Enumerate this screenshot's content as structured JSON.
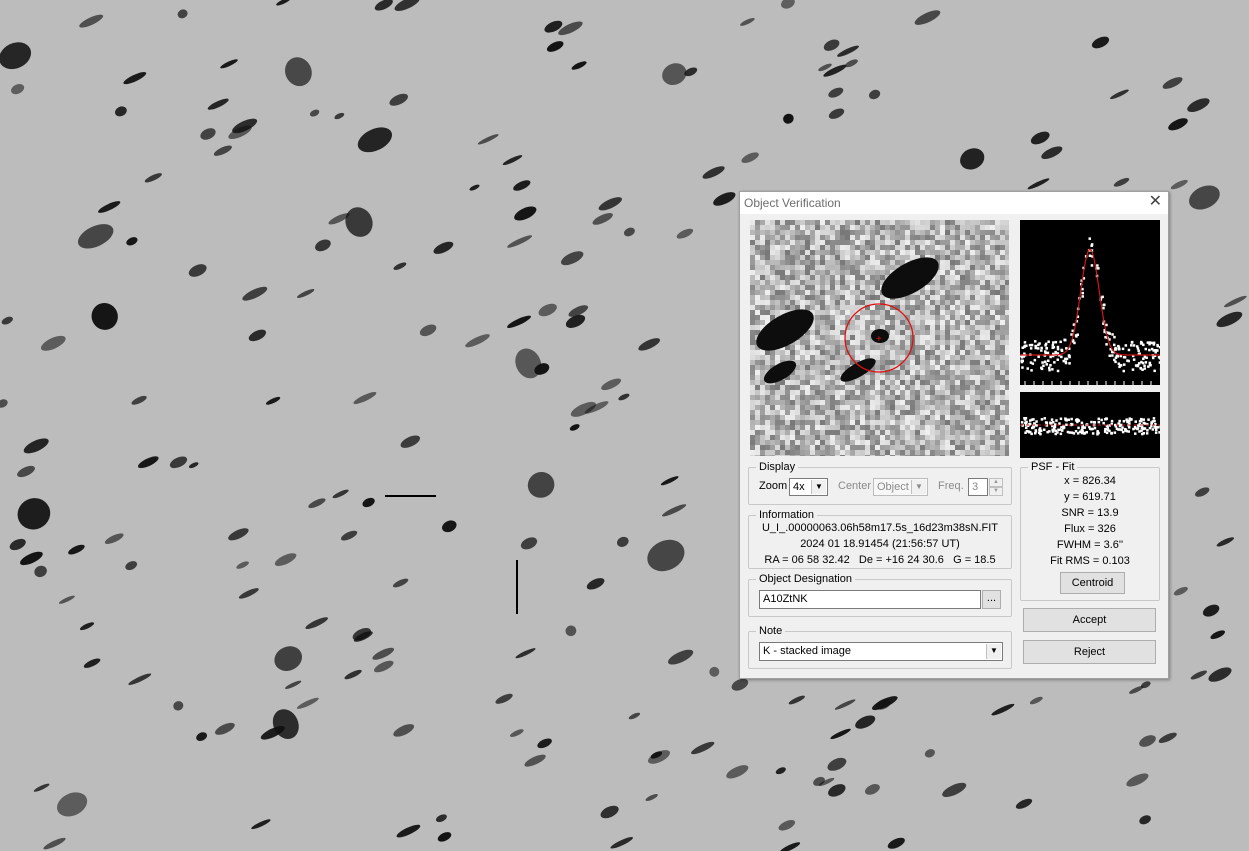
{
  "dialog": {
    "title": "Object Verification",
    "close_glyph": "✕"
  },
  "display": {
    "legend": "Display",
    "zoom_label": "Zoom",
    "zoom_value": "4x",
    "center_label": "Center",
    "center_value": "Object",
    "freq_label": "Freq.",
    "freq_value": "3"
  },
  "information": {
    "legend": "Information",
    "file": "U_I_.00000063.06h58m17.5s_16d23m38sN.FIT",
    "date": "2024 01 18.91454 (21:56:57 UT)",
    "coords": "RA = 06 58 32.42   De = +16 24 30.6   G = 18.5"
  },
  "designation": {
    "legend": "Object Designation",
    "value": "A10ZtNK",
    "browse_label": "..."
  },
  "note": {
    "legend": "Note",
    "value": "K - stacked image"
  },
  "psf_fit": {
    "legend": "PSF - Fit",
    "x": "x = 826.34",
    "y": "y = 619.71",
    "snr": "SNR = 13.9",
    "flux": "Flux = 326",
    "fwhm": "FWHM = 3.6''",
    "fit_rms": "Fit RMS = 0.103",
    "centroid_label": "Centroid"
  },
  "buttons": {
    "accept_label": "Accept",
    "reject_label": "Reject"
  },
  "colors": {
    "marker": "#e01010",
    "fit_curve": "#d01818",
    "points": "#ffffff"
  }
}
